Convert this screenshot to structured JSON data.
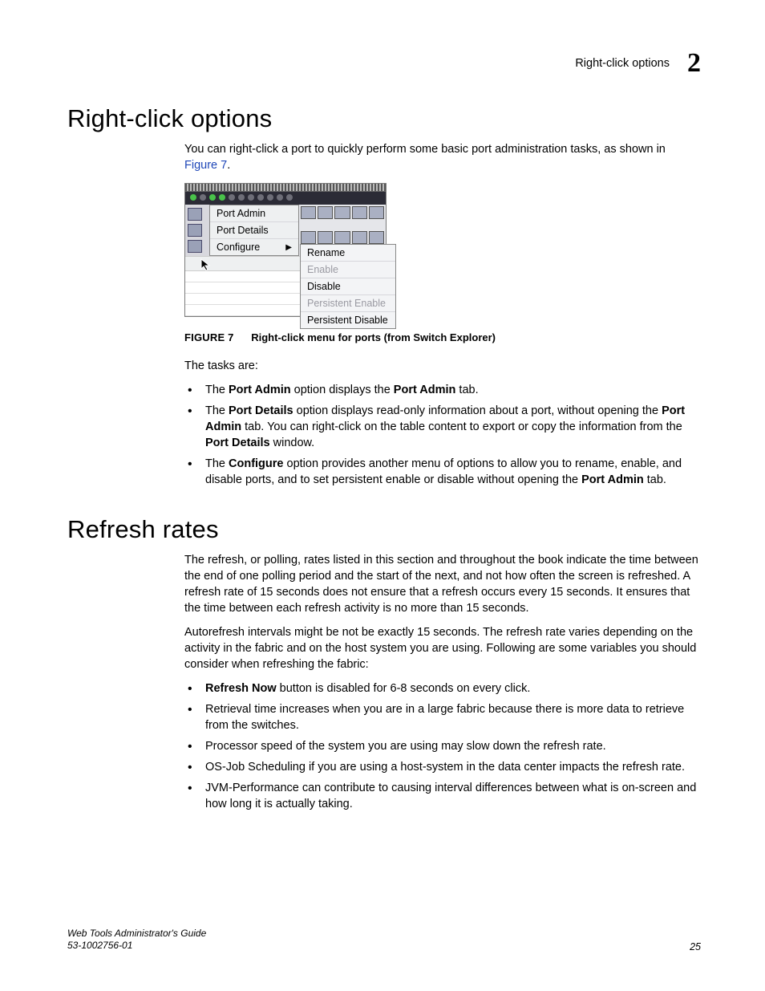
{
  "header": {
    "section_label": "Right-click options",
    "chapter_number": "2"
  },
  "sections": {
    "rco": {
      "title": "Right-click options",
      "intro_prefix": "You can right-click a port to quickly perform some basic port administration tasks, as shown in ",
      "figure_ref": "Figure 7",
      "intro_suffix": ".",
      "tasks_intro": "The tasks are:"
    },
    "refresh": {
      "title": "Refresh rates",
      "p1": "The refresh, or polling, rates listed in this section and throughout the book indicate the time between the end of one polling period and the start of the next, and not how often the screen is refreshed. A refresh rate of 15 seconds does not ensure that a refresh occurs every 15 seconds. It ensures that the time between each refresh activity is no more than 15 seconds.",
      "p2": "Autorefresh intervals might be not be exactly 15 seconds. The refresh rate varies depending on the activity in the fabric and on the host system you are using. Following are some variables you should consider when refreshing the fabric:"
    }
  },
  "figure": {
    "label": "FIGURE 7",
    "caption": "Right-click menu for ports (from Switch Explorer)",
    "menu1": {
      "i1": "Port Admin",
      "i2": "Port Details",
      "i3": "Configure"
    },
    "submenu": {
      "i1": "Rename",
      "i2": "Enable",
      "i3": "Disable",
      "i4": "Persistent Enable",
      "i5": "Persistent Disable"
    }
  },
  "bullets_rco": {
    "b1": {
      "pre": "The ",
      "s1": "Port Admin",
      "mid": " option displays the ",
      "s2": "Port Admin",
      "post": " tab."
    },
    "b2": {
      "pre": "The ",
      "s1": "Port Details",
      "mid": " option displays read-only information about a port, without opening the ",
      "s2": "Port Admin",
      "mid2": " tab. You can right-click on the table content to export or copy the information from the ",
      "s3": "Port Details",
      "post": " window."
    },
    "b3": {
      "pre": "The ",
      "s1": "Configure",
      "mid": " option provides another menu of options to allow you to rename, enable, and disable ports, and to set persistent enable or disable without opening the ",
      "s2": "Port Admin",
      "post": " tab."
    }
  },
  "bullets_refresh": {
    "b1": {
      "s1": "Refresh Now",
      "post": " button is disabled for 6-8 seconds on every click."
    },
    "b2": "Retrieval time increases when you are in a large fabric because there is more data to retrieve from the switches.",
    "b3": "Processor speed of the system you are using may slow down the refresh rate.",
    "b4": "OS-Job Scheduling if you are using a host-system in the data center impacts the refresh rate.",
    "b5": "JVM-Performance can contribute to causing interval differences between what is on-screen and how long it is actually taking."
  },
  "footer": {
    "book": "Web Tools Administrator's Guide",
    "docnum": "53-1002756-01",
    "page": "25"
  }
}
